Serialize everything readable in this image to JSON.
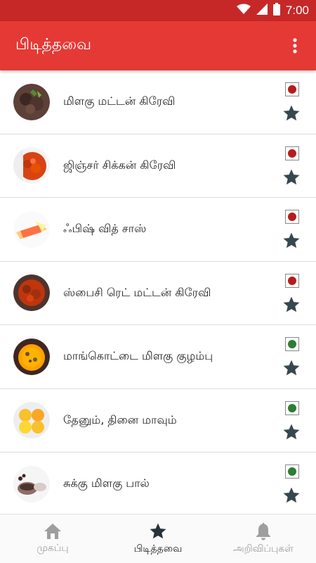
{
  "status_bar": {
    "time": "7:00"
  },
  "app_bar": {
    "title": "பிடித்தவை"
  },
  "recipes": [
    {
      "name": "மிளகு மட்டன் கிரேவி",
      "type": "non-veg",
      "thumb": "mutton"
    },
    {
      "name": "ஜிஞ்சர் சிக்கன் கிரேவி",
      "type": "non-veg",
      "thumb": "chicken"
    },
    {
      "name": "ஃபிஷ் வித் சாஸ்",
      "type": "non-veg",
      "thumb": "fish"
    },
    {
      "name": "ஸ்பைசி ரெட் மட்டன் கிரேவி",
      "type": "non-veg",
      "thumb": "redmutton"
    },
    {
      "name": "மாங்கொட்டை மிளகு குழம்பு",
      "type": "veg",
      "thumb": "kuzhambu"
    },
    {
      "name": "தேனும், தினை மாவும்",
      "type": "veg",
      "thumb": "laddu"
    },
    {
      "name": "சுக்கு மிளகு பால்",
      "type": "veg",
      "thumb": "spices"
    }
  ],
  "colors": {
    "non_veg": "#b71c1c",
    "veg": "#2e7d32",
    "star": "#37474f",
    "app_bar": "#e53935"
  },
  "bottom_nav": [
    {
      "label": "முகப்பு",
      "icon": "home-icon",
      "active": false
    },
    {
      "label": "பிடித்தவை",
      "icon": "star-icon",
      "active": true
    },
    {
      "label": "அறிவிப்புகள்",
      "icon": "bell-icon",
      "active": false
    }
  ]
}
